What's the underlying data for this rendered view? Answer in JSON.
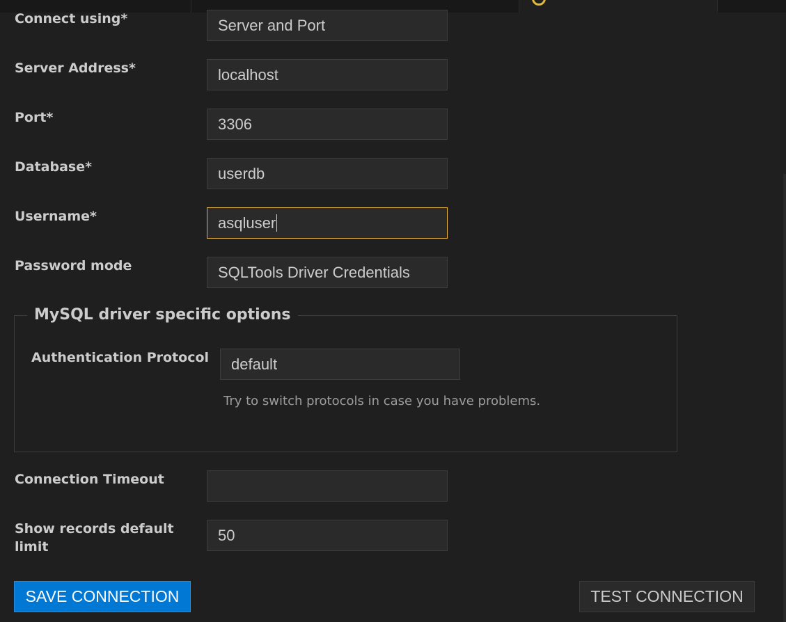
{
  "form": {
    "fields": [
      {
        "label": "Connect using*",
        "value": "Server and Port"
      },
      {
        "label": "Server Address*",
        "value": "localhost"
      },
      {
        "label": "Port*",
        "value": "3306"
      },
      {
        "label": "Database*",
        "value": "userdb"
      },
      {
        "label": "Username*",
        "value": "asqluser"
      },
      {
        "label": "Password mode",
        "value": "SQLTools Driver Credentials"
      }
    ],
    "driver_group": {
      "legend": "MySQL driver specific options",
      "auth_label": "Authentication Protocol",
      "auth_value": "default",
      "auth_help": "Try to switch protocols in case you have problems."
    },
    "timeout": {
      "label": "Connection Timeout",
      "value": ""
    },
    "records_limit": {
      "label": "Show records default limit",
      "value": "50"
    }
  },
  "buttons": {
    "save": "SAVE CONNECTION",
    "test": "TEST CONNECTION"
  },
  "colors": {
    "background": "#1f1f1f",
    "input_bg": "#2a2a2a",
    "focus_border": "#e7b23d",
    "primary_button": "#0078d4"
  }
}
